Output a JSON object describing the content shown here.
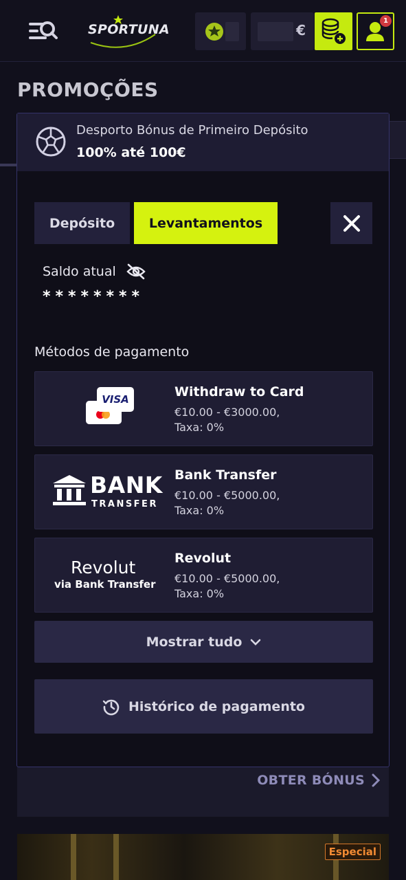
{
  "header": {
    "logo_text": "SPORTUNA",
    "balance_currency": "€",
    "notification_count": "1"
  },
  "page": {
    "title": "PROMOÇÕES",
    "obter_bonus": "OBTER BÓNUS",
    "banner_badge": "Especial"
  },
  "promo": {
    "title": "Desporto Bónus de Primeiro Depósito",
    "value": "100% até 100€"
  },
  "tabs": {
    "deposit": "Depósito",
    "withdraw": "Levantamentos",
    "active": "withdraw"
  },
  "balance": {
    "label": "Saldo atual",
    "hidden_value": "********"
  },
  "methods": {
    "label": "Métodos de pagamento",
    "items": [
      {
        "name": "Withdraw to Card",
        "range": "€10.00 - €3000.00,",
        "fee": "Taxa: 0%",
        "logo": "card-logo",
        "logo_text": "VISA"
      },
      {
        "name": "Bank Transfer",
        "range": "€10.00 - €5000.00,",
        "fee": "Taxa: 0%",
        "logo": "bank-logo",
        "logo_text": "BANK",
        "logo_sub": "TRANSFER"
      },
      {
        "name": "Revolut",
        "range": "€10.00 - €5000.00,",
        "fee": "Taxa: 0%",
        "logo": "revolut-logo",
        "logo_text": "Revolut",
        "logo_sub": "via Bank Transfer"
      }
    ]
  },
  "buttons": {
    "show_all": "Mostrar tudo",
    "history": "Histórico de pagamento"
  },
  "colors": {
    "accent": "#d5f20f",
    "background": "#11101c",
    "card": "#1f1d33"
  }
}
